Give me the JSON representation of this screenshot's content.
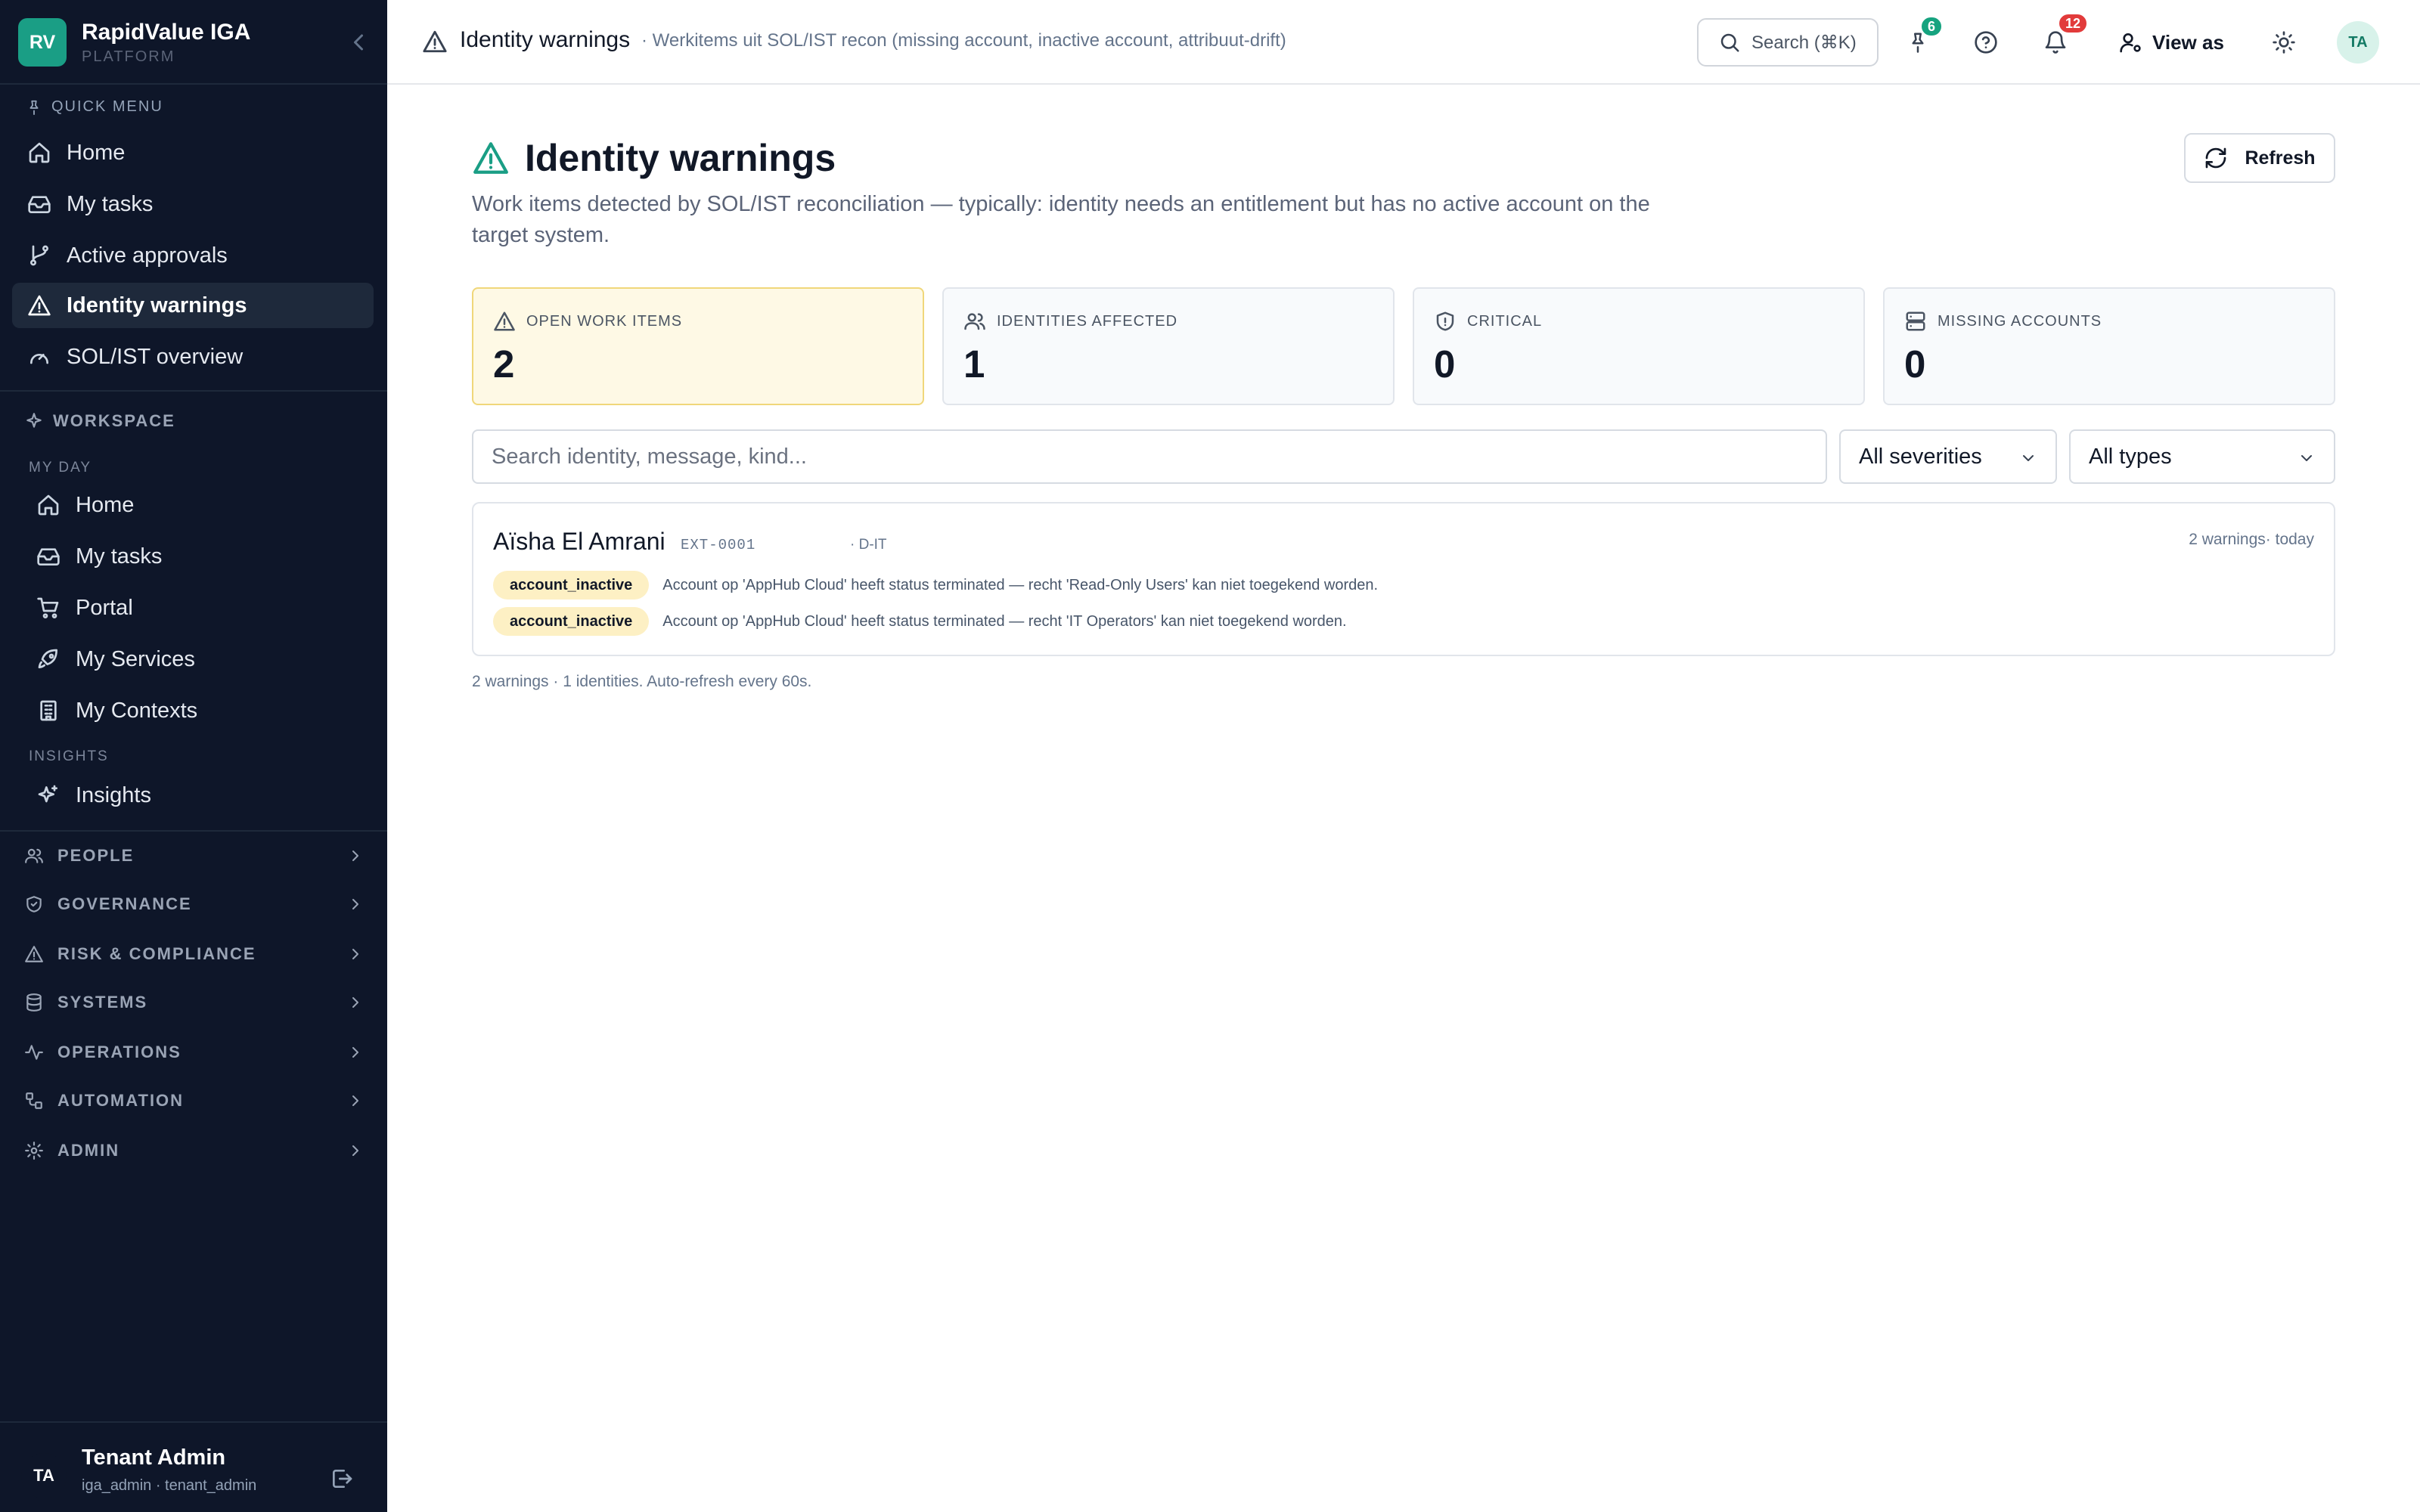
{
  "app": {
    "logo": "RV",
    "name": "RapidValue IGA",
    "sub": "PLATFORM"
  },
  "quick_menu": {
    "title": "QUICK MENU",
    "items": [
      {
        "label": "Home",
        "icon": "home-icon"
      },
      {
        "label": "My tasks",
        "icon": "inbox-icon"
      },
      {
        "label": "Active approvals",
        "icon": "git-branch-icon"
      },
      {
        "label": "Identity warnings",
        "icon": "warning-icon",
        "active": true
      },
      {
        "label": "SOL/IST overview",
        "icon": "gauge-icon"
      }
    ]
  },
  "workspace": {
    "title": "WORKSPACE",
    "my_day_title": "MY DAY",
    "my_day": [
      {
        "label": "Home",
        "icon": "home-icon"
      },
      {
        "label": "My tasks",
        "icon": "inbox-icon"
      },
      {
        "label": "Portal",
        "icon": "cart-icon"
      },
      {
        "label": "My Services",
        "icon": "rocket-icon"
      },
      {
        "label": "My Contexts",
        "icon": "building-icon"
      }
    ],
    "insights_title": "INSIGHTS",
    "insights": [
      {
        "label": "Insights",
        "icon": "sparkle-icon"
      }
    ]
  },
  "groups": [
    "PEOPLE",
    "GOVERNANCE",
    "RISK & COMPLIANCE",
    "SYSTEMS",
    "OPERATIONS",
    "AUTOMATION",
    "ADMIN"
  ],
  "user": {
    "initials": "TA",
    "name": "Tenant Admin",
    "role": "iga_admin · tenant_admin"
  },
  "topbar": {
    "title": "Identity warnings",
    "subtitle": "· Werkitems uit SOL/IST recon (missing account, inactive account, attribuut-drift)",
    "search_label": "Search (⌘K)",
    "pin_badge": "6",
    "notif_badge": "12",
    "view_as": "View as",
    "avatar": "TA"
  },
  "page": {
    "title": "Identity warnings",
    "description": "Work items detected by SOL/IST reconciliation — typically: identity needs an entitlement but has no active account on the target system.",
    "refresh": "Refresh"
  },
  "stats": [
    {
      "label": "OPEN WORK ITEMS",
      "value": "2",
      "icon": "warning-icon"
    },
    {
      "label": "IDENTITIES AFFECTED",
      "value": "1",
      "icon": "users-icon"
    },
    {
      "label": "CRITICAL",
      "value": "0",
      "icon": "shield-icon"
    },
    {
      "label": "MISSING ACCOUNTS",
      "value": "0",
      "icon": "server-icon"
    }
  ],
  "filters": {
    "search_placeholder": "Search identity, message, kind...",
    "severity": "All severities",
    "type": "All types"
  },
  "identity": {
    "name": "Aïsha El Amrani",
    "id": "EXT-0001",
    "dept": "· D-IT",
    "meta": "2 warnings· today",
    "warnings": [
      {
        "kind": "account_inactive",
        "message": "Account op 'AppHub Cloud' heeft status terminated — recht 'Read-Only Users' kan niet toegekend worden."
      },
      {
        "kind": "account_inactive",
        "message": "Account op 'AppHub Cloud' heeft status terminated — recht 'IT Operators' kan niet toegekend worden."
      }
    ]
  },
  "footer": "2 warnings · 1 identities. Auto-refresh every 60s.",
  "colors": {
    "sidebar": "#0e1629",
    "accent": "#1a9e85",
    "warning_bg": "#fef9e5",
    "pill": "#fdf0c4",
    "badge_green": "#16a37f",
    "badge_red": "#e23b3b"
  }
}
